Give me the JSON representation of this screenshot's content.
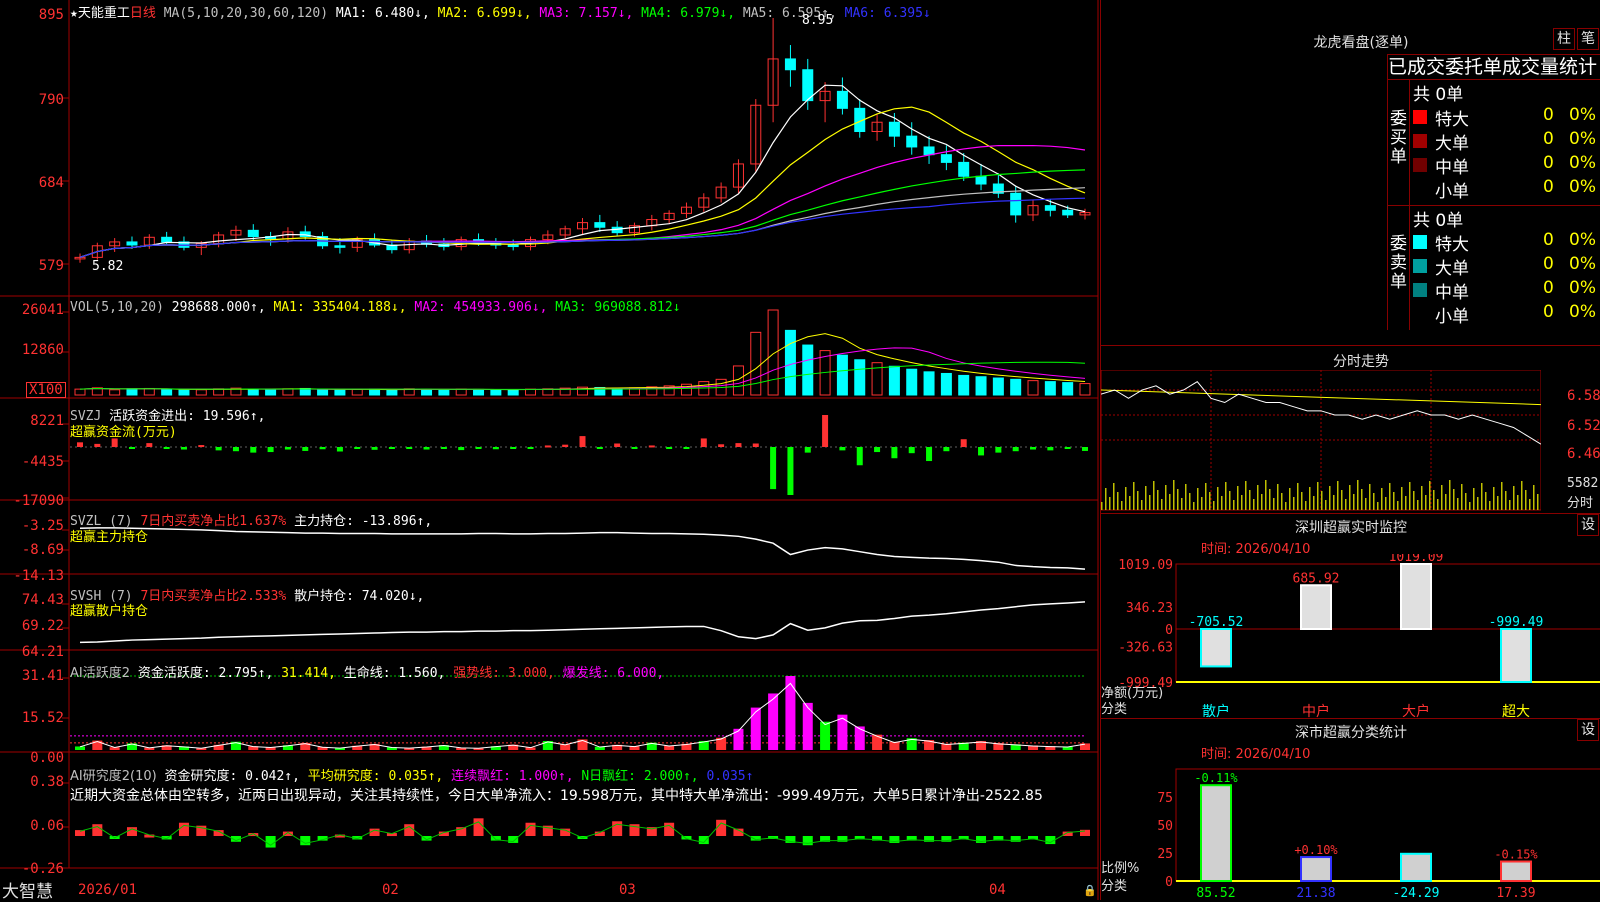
{
  "main_chart": {
    "header": {
      "star": "★",
      "stock": "天能重工",
      "period": "日线",
      "ma_def": "MA(5,10,20,30,60,120)",
      "ma1": "MA1: 6.480↓,",
      "ma2": "MA2: 6.699↓,",
      "ma3": "MA3: 7.157↓,",
      "ma4": "MA4: 6.979↓,",
      "ma5": "MA5: 6.595↑,",
      "ma6": "MA6: 6.395↓"
    },
    "y_ticks": [
      "895",
      "790",
      "684",
      "579"
    ],
    "high_label": "8.95",
    "low_label": "5.82"
  },
  "vol_panel": {
    "header": {
      "def": "VOL(5,10,20)",
      "vol": "298688.000↑,",
      "ma1": "MA1: 335404.188↓,",
      "ma2": "MA2: 454933.906↓,",
      "ma3": "MA3: 969088.812↓"
    },
    "y_ticks": [
      "26041",
      "12860"
    ],
    "unit": "X100"
  },
  "svzj_panel": {
    "header": {
      "name": "SVZJ",
      "label": "活跃资金进出: 19.596↑,"
    },
    "sub": "超赢资金流(万元)",
    "y_ticks": [
      "8221",
      "-4435",
      "-17090"
    ]
  },
  "svzl_panel": {
    "header": {
      "name": "SVZL (7)",
      "pct": "7日内买卖净占比1.637%",
      "val": "主力持仓: -13.896↑,"
    },
    "sub": "超赢主力持仓",
    "y_ticks": [
      "-3.25",
      "-8.69",
      "-14.13"
    ]
  },
  "svsh_panel": {
    "header": {
      "name": "SVSH (7)",
      "pct": "7日内买卖净占比2.533%",
      "val": "散户持仓: 74.020↓,"
    },
    "sub": "超赢散户持仓",
    "y_ticks": [
      "74.43",
      "69.22",
      "64.21"
    ]
  },
  "ai2_panel": {
    "header": {
      "name": "AI活跃度2",
      "a": "资金活跃度: 2.795↑,",
      "b": "31.414,",
      "c": "生命线: 1.560,",
      "d": "强势线: 3.000,",
      "e": "爆发线: 6.000,"
    },
    "y_ticks": [
      "31.41",
      "15.52",
      "0.00"
    ]
  },
  "ai3_panel": {
    "header": {
      "name": "AI研究度2(10)",
      "a": "资金研究度: 0.042↑,",
      "b": "平均研究度: 0.035↑,",
      "c": "连续飘红: 1.000↑,",
      "d": "N日飘红: 2.000↑,",
      "e": "0.035↑"
    },
    "commentary": "近期大资金总体由空转多，近两日出现异动，关注其持续性，今日大单净流入：19.598万元，其中特大单净流出：-999.49万元，大单5日累计净出-2522.85",
    "y_ticks": [
      "0.38",
      "0.06",
      "-0.26"
    ]
  },
  "x_axis": {
    "labels": [
      "2026/01",
      "02",
      "03",
      "04"
    ],
    "brand": "大智慧"
  },
  "chart_data": [
    {
      "type": "candlestick",
      "title": "天能重工 日线",
      "ylim": [
        579,
        895
      ],
      "ohlc": [
        [
          583,
          590,
          578,
          585
        ],
        [
          585,
          604,
          582,
          600
        ],
        [
          600,
          610,
          592,
          605
        ],
        [
          605,
          612,
          596,
          601
        ],
        [
          601,
          615,
          596,
          611
        ],
        [
          611,
          618,
          602,
          605
        ],
        [
          605,
          612,
          594,
          598
        ],
        [
          598,
          606,
          588,
          603
        ],
        [
          603,
          618,
          598,
          614
        ],
        [
          614,
          626,
          606,
          620
        ],
        [
          620,
          628,
          606,
          612
        ],
        [
          612,
          618,
          600,
          609
        ],
        [
          609,
          624,
          604,
          618
        ],
        [
          618,
          626,
          608,
          612
        ],
        [
          612,
          618,
          596,
          600
        ],
        [
          600,
          610,
          590,
          598
        ],
        [
          598,
          612,
          592,
          608
        ],
        [
          608,
          616,
          598,
          601
        ],
        [
          601,
          608,
          590,
          595
        ],
        [
          595,
          610,
          590,
          606
        ],
        [
          606,
          614,
          598,
          602
        ],
        [
          602,
          610,
          594,
          599
        ],
        [
          599,
          612,
          594,
          608
        ],
        [
          608,
          616,
          600,
          603
        ],
        [
          603,
          610,
          596,
          601
        ],
        [
          601,
          608,
          594,
          599
        ],
        [
          599,
          612,
          594,
          608
        ],
        [
          608,
          620,
          602,
          614
        ],
        [
          614,
          626,
          608,
          622
        ],
        [
          622,
          636,
          614,
          630
        ],
        [
          630,
          640,
          618,
          624
        ],
        [
          624,
          632,
          612,
          617
        ],
        [
          617,
          630,
          612,
          626
        ],
        [
          626,
          640,
          620,
          634
        ],
        [
          634,
          646,
          628,
          642
        ],
        [
          642,
          656,
          636,
          650
        ],
        [
          650,
          668,
          644,
          662
        ],
        [
          662,
          682,
          656,
          676
        ],
        [
          676,
          712,
          668,
          706
        ],
        [
          706,
          790,
          696,
          782
        ],
        [
          782,
          895,
          760,
          842
        ],
        [
          842,
          860,
          806,
          828
        ],
        [
          828,
          842,
          776,
          788
        ],
        [
          788,
          812,
          760,
          800
        ],
        [
          800,
          818,
          770,
          778
        ],
        [
          778,
          790,
          740,
          748
        ],
        [
          748,
          770,
          736,
          760
        ],
        [
          760,
          772,
          728,
          742
        ],
        [
          742,
          760,
          718,
          728
        ],
        [
          728,
          742,
          706,
          718
        ],
        [
          718,
          730,
          698,
          708
        ],
        [
          708,
          720,
          684,
          690
        ],
        [
          690,
          706,
          672,
          680
        ],
        [
          680,
          694,
          662,
          668
        ],
        [
          668,
          678,
          630,
          640
        ],
        [
          640,
          660,
          632,
          652
        ],
        [
          652,
          660,
          638,
          646
        ],
        [
          646,
          652,
          636,
          640
        ],
        [
          640,
          648,
          634,
          643
        ]
      ],
      "ma_series": [
        {
          "name": "MA1",
          "color": "#ffffff"
        },
        {
          "name": "MA2",
          "color": "#ffff00"
        },
        {
          "name": "MA3",
          "color": "#ff00ff"
        },
        {
          "name": "MA4",
          "color": "#00ff00"
        },
        {
          "name": "MA5",
          "color": "#c0c0c0"
        },
        {
          "name": "MA6",
          "color": "#3232ff"
        }
      ]
    },
    {
      "type": "bar",
      "title": "VOL",
      "ylim": [
        0,
        26041
      ],
      "values": [
        1800,
        2200,
        1600,
        1900,
        2000,
        1700,
        1500,
        1600,
        1900,
        2100,
        1800,
        1700,
        1900,
        2000,
        1600,
        1500,
        1700,
        1800,
        1600,
        1900,
        1700,
        1600,
        1800,
        1700,
        1600,
        1500,
        1800,
        1900,
        2100,
        2400,
        2300,
        2100,
        2200,
        2500,
        2800,
        3300,
        4100,
        4800,
        8900,
        19200,
        26041,
        19800,
        15300,
        13600,
        12200,
        10800,
        9900,
        8800,
        7900,
        7100,
        6600,
        6000,
        5600,
        5200,
        4800,
        4400,
        4100,
        3800,
        3500
      ]
    },
    {
      "type": "bar",
      "title": "SVZJ 活跃资金进出",
      "ylim": [
        -17090,
        8221
      ],
      "values": [
        1200,
        800,
        2200,
        -600,
        1000,
        -400,
        -900,
        500,
        -1200,
        -1500,
        -2000,
        -1800,
        -900,
        -1400,
        -800,
        -1600,
        -700,
        -1000,
        -500,
        -600,
        -900,
        -700,
        -1100,
        -500,
        -800,
        -400,
        -700,
        400,
        600,
        2800,
        -600,
        900,
        -500,
        400,
        -300,
        -400,
        2200,
        700,
        1000,
        900,
        -15000,
        -17090,
        -2000,
        8221,
        -1200,
        -6500,
        -1800,
        -4000,
        -2200,
        -5000,
        -1500,
        2000,
        -3000,
        -2000,
        -1500,
        -900,
        -1200,
        -600,
        -1400
      ]
    },
    {
      "type": "line",
      "title": "SVZL 主力持仓",
      "ylim": [
        -14.13,
        -3.25
      ],
      "values": [
        -3.8,
        -3.7,
        -3.7,
        -3.8,
        -3.9,
        -4.0,
        -4.1,
        -4.2,
        -4.4,
        -4.6,
        -4.7,
        -4.8,
        -4.9,
        -5.0,
        -5.0,
        -5.1,
        -5.1,
        -5.1,
        -5.2,
        -5.2,
        -5.2,
        -5.2,
        -5.2,
        -5.1,
        -5.1,
        -5.2,
        -5.2,
        -5.1,
        -5.1,
        -5.0,
        -4.9,
        -4.9,
        -5.0,
        -5.1,
        -5.1,
        -5.2,
        -5.3,
        -5.5,
        -5.8,
        -6.5,
        -7.5,
        -10.3,
        -9.2,
        -8.6,
        -8.9,
        -9.6,
        -10.3,
        -10.8,
        -11.0,
        -11.2,
        -11.3,
        -11.5,
        -11.8,
        -12.2,
        -13.0,
        -13.3,
        -13.5,
        -13.6,
        -13.9
      ]
    },
    {
      "type": "line",
      "title": "SVSH 散户持仓",
      "ylim": [
        64.21,
        74.43
      ],
      "values": [
        65.4,
        65.5,
        65.7,
        65.9,
        66.0,
        66.1,
        66.2,
        66.3,
        66.5,
        66.6,
        66.7,
        66.8,
        66.9,
        67.0,
        67.1,
        67.2,
        67.3,
        67.4,
        67.5,
        67.6,
        67.6,
        67.7,
        67.7,
        67.8,
        67.8,
        67.9,
        67.9,
        68.0,
        68.1,
        68.2,
        68.3,
        68.4,
        68.5,
        68.6,
        68.7,
        68.8,
        68.8,
        67.9,
        66.6,
        66.2,
        67.0,
        69.4,
        68.0,
        68.5,
        69.5,
        70.0,
        70.1,
        70.5,
        71.0,
        71.2,
        71.5,
        71.9,
        72.3,
        72.6,
        73.0,
        73.4,
        73.6,
        73.8,
        74.02
      ]
    },
    {
      "type": "bar",
      "title": "AI活跃度2",
      "ylim": [
        0,
        31.41
      ],
      "values": [
        1.5,
        4.0,
        1.2,
        2.8,
        1.0,
        2.0,
        1.5,
        0.8,
        2.2,
        3.5,
        1.6,
        1.2,
        2.0,
        3.0,
        1.3,
        0.9,
        1.8,
        2.6,
        1.2,
        0.9,
        1.4,
        2.1,
        1.0,
        0.8,
        1.6,
        2.3,
        1.1,
        3.8,
        2.4,
        4.5,
        1.4,
        2.2,
        1.6,
        3.1,
        1.9,
        2.6,
        3.8,
        5.2,
        9.0,
        18.0,
        24.0,
        31.41,
        20.0,
        12.0,
        15.0,
        10.0,
        6.5,
        3.5,
        5.0,
        4.2,
        2.6,
        3.1,
        3.8,
        2.9,
        2.4,
        1.9,
        1.6,
        1.4,
        2.795
      ]
    },
    {
      "type": "bar",
      "title": "AI研究度2(10)",
      "ylim": [
        -0.26,
        0.38
      ],
      "values": [
        0.04,
        0.08,
        -0.02,
        0.06,
        0.01,
        -0.03,
        0.09,
        0.07,
        0.04,
        -0.05,
        0.02,
        -0.1,
        0.03,
        -0.08,
        -0.04,
        0.01,
        -0.03,
        0.05,
        0.02,
        0.08,
        -0.04,
        0.03,
        0.06,
        0.12,
        -0.04,
        -0.06,
        0.09,
        0.07,
        0.05,
        -0.02,
        0.03,
        0.1,
        0.08,
        0.06,
        0.09,
        -0.03,
        -0.07,
        0.11,
        0.05,
        -0.04,
        -0.02,
        -0.06,
        -0.08,
        -0.05,
        -0.05,
        -0.03,
        -0.04,
        -0.06,
        -0.04,
        -0.05,
        -0.05,
        -0.03,
        -0.06,
        -0.04,
        -0.05,
        -0.03,
        -0.07,
        0.03,
        0.042
      ]
    },
    {
      "type": "line",
      "title": "分时走势",
      "ylim": [
        6.46,
        6.58
      ],
      "values": [
        6.57,
        6.58,
        6.56,
        6.58,
        6.59,
        6.57,
        6.58,
        6.6,
        6.56,
        6.55,
        6.57,
        6.56,
        6.55,
        6.55,
        6.54,
        6.53,
        6.53,
        6.52,
        6.52,
        6.51,
        6.52,
        6.51,
        6.52,
        6.53,
        6.52,
        6.52,
        6.51,
        6.52,
        6.51,
        6.5,
        6.49,
        6.47,
        6.45
      ]
    },
    {
      "type": "bar",
      "title": "深圳超赢实时监控",
      "categories": [
        "散户",
        "中户",
        "大户",
        "超大"
      ],
      "values": [
        -705.52,
        685.92,
        1019.09,
        -999.49
      ],
      "ylabel": "净额(万元)",
      "ylim": [
        -999.49,
        1019.09
      ]
    },
    {
      "type": "bar",
      "title": "深市超赢分类统计",
      "categories": [
        "散户",
        "中户",
        "大户",
        "超大"
      ],
      "values": [
        85.52,
        21.38,
        -24.29,
        17.39
      ],
      "pct_labels": [
        "-0.11%",
        "+0.10%",
        "",
        "-0.15%"
      ],
      "ylabel": "比例%"
    }
  ],
  "right_panel": {
    "lhkp": {
      "title": "龙虎看盘(逐单)",
      "btn1": "柱",
      "btn2": "笔",
      "heading": "已成交委托单成交量统计",
      "buy_label": "委买单",
      "buy_total": "共 0单",
      "sell_label": "委卖单",
      "sell_total": "共 0单",
      "buy_rows": [
        {
          "color": "#ff0000",
          "name": "特大",
          "cnt": "0",
          "pct": "0%"
        },
        {
          "color": "#a00000",
          "name": "大单",
          "cnt": "0",
          "pct": "0%"
        },
        {
          "color": "#700000",
          "name": "中单",
          "cnt": "0",
          "pct": "0%"
        },
        {
          "color": "",
          "name": "小单",
          "cnt": "0",
          "pct": "0%"
        }
      ],
      "sell_rows": [
        {
          "color": "#00ffff",
          "name": "特大",
          "cnt": "0",
          "pct": "0%"
        },
        {
          "color": "#00a0a0",
          "name": "大单",
          "cnt": "0",
          "pct": "0%"
        },
        {
          "color": "#008080",
          "name": "中单",
          "cnt": "0",
          "pct": "0%"
        },
        {
          "color": "",
          "name": "小单",
          "cnt": "0",
          "pct": "0%"
        }
      ]
    },
    "fenshi": {
      "title": "分时走势",
      "prices": [
        "6.58",
        "6.52",
        "6.46"
      ],
      "vol_label": "5582",
      "unit": "分时"
    },
    "sz_monitor": {
      "title": "深圳超赢实时监控",
      "settings": "设",
      "date": "时间: 2026/04/10",
      "y_ticks": [
        "1019.09",
        "346.23",
        "0",
        "-326.63",
        "-999.49"
      ],
      "ylabel": "净额(万元)",
      "xcat_label": "分类",
      "cats": [
        "散户",
        "中户",
        "大户",
        "超大"
      ],
      "vals": [
        "-705.52",
        "685.92",
        "1019.09",
        "-999.49"
      ]
    },
    "sz_class": {
      "title": "深市超赢分类统计",
      "settings": "设",
      "date": "时间: 2026/04/10",
      "y_ticks": [
        "75",
        "50",
        "25",
        "0"
      ],
      "ylabel": "比例%",
      "xcat_label": "分类",
      "cats": [
        "散户",
        "中户",
        "大户",
        "超大"
      ],
      "vals": [
        "85.52",
        "21.38",
        "-24.29",
        "17.39"
      ],
      "pct": [
        "-0.11%",
        "+0.10%",
        "",
        "-0.15%"
      ]
    }
  }
}
